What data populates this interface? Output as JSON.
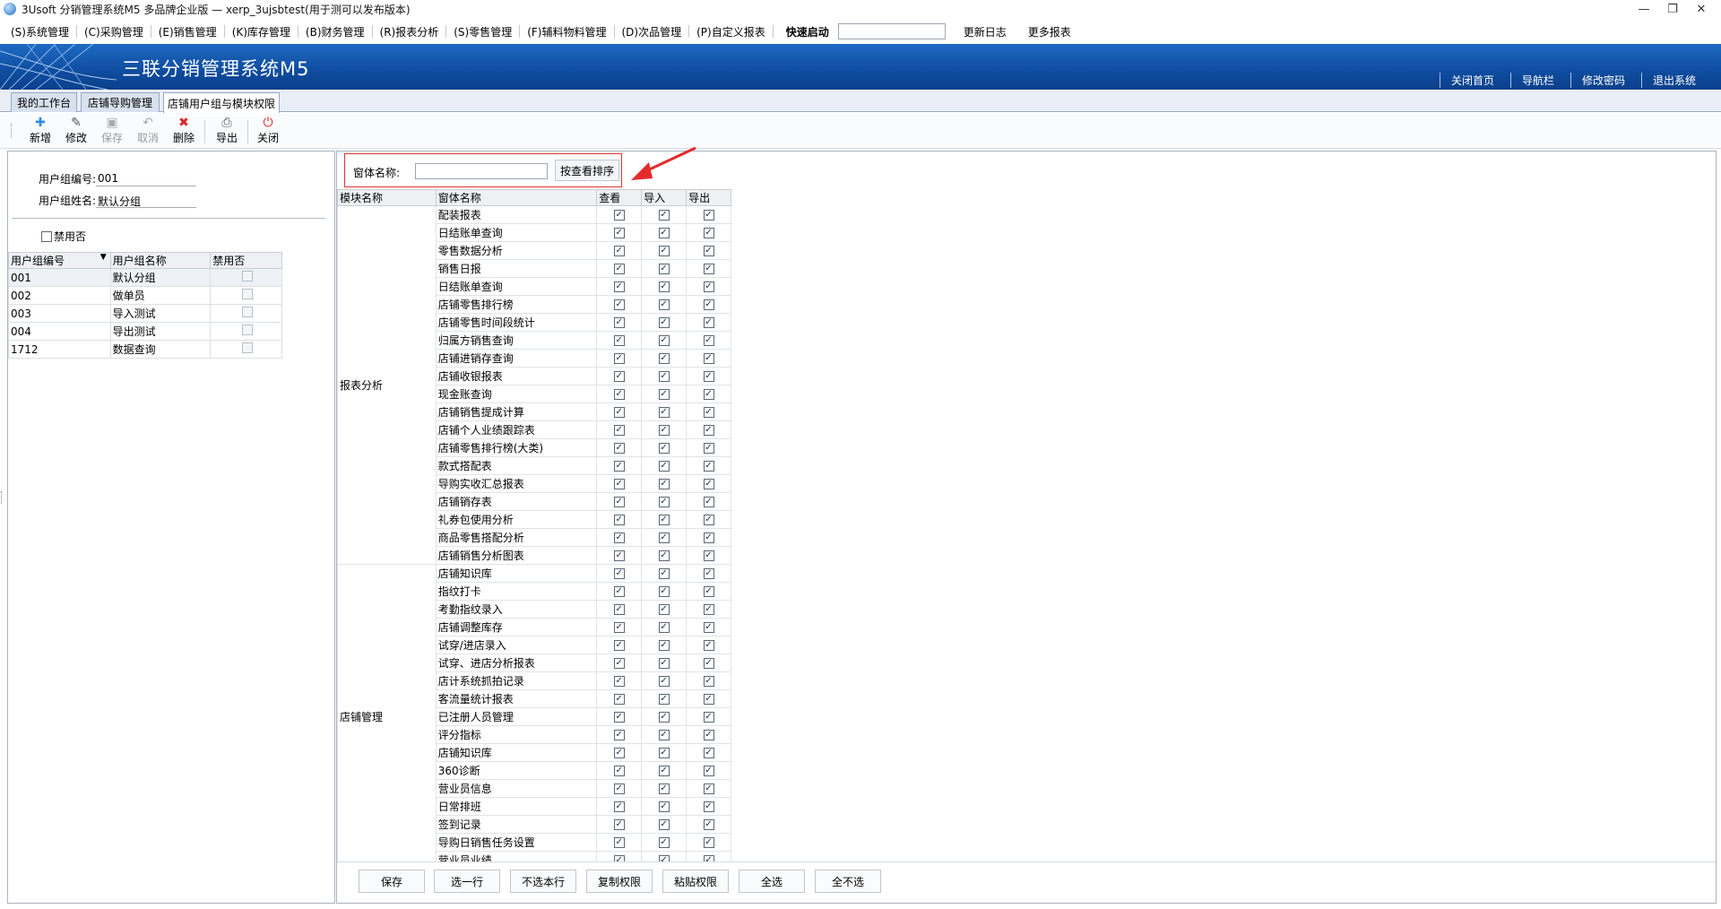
{
  "window": {
    "title": "3Usoft 分销管理系统M5 多品牌企业版 — xerp_3ujsbtest(用于测可以发布版本)",
    "buttons": [
      "—",
      "❐",
      "✕"
    ]
  },
  "menubar": {
    "items": [
      "(S)系统管理",
      "(C)采购管理",
      "(E)销售管理",
      "(K)库存管理",
      "(B)财务管理",
      "(R)报表分析",
      "(S)零售管理",
      "(F)辅料物料管理",
      "(D)次品管理",
      "(P)自定义报表"
    ],
    "quick_launch_label": "快速启动",
    "quick_launch_value": "",
    "extra_links": [
      "更新日志",
      "更多报表"
    ]
  },
  "banner": {
    "title": "三联分销管理系统M5",
    "links": [
      "关闭首页",
      "导航栏",
      "修改密码",
      "退出系统"
    ]
  },
  "tabs": [
    "我的工作台",
    "店铺导购管理",
    "店铺用户组与模块权限"
  ],
  "toolbar": {
    "new": "新增",
    "edit": "修改",
    "save": "保存",
    "cancel": "取消",
    "delete": "删除",
    "export": "导出",
    "close": "关闭"
  },
  "group_form": {
    "code_label": "用户组编号:",
    "code_value": "001",
    "name_label": "用户组姓名:",
    "name_value": "默认分组",
    "disabled_label": "禁用否"
  },
  "group_grid": {
    "headers": [
      "用户组编号",
      "用户组名称",
      "禁用否"
    ],
    "rows": [
      {
        "code": "001",
        "name": "默认分组"
      },
      {
        "code": "002",
        "name": "做单员"
      },
      {
        "code": "003",
        "name": "导入测试"
      },
      {
        "code": "004",
        "name": "导出测试"
      },
      {
        "code": "1712",
        "name": "数据查询"
      }
    ]
  },
  "search": {
    "label": "窗体名称:",
    "value": "",
    "button": "按查看排序"
  },
  "perm_grid": {
    "headers": [
      "模块名称",
      "窗体名称",
      "查看",
      "导入",
      "导出"
    ],
    "groups": [
      {
        "module": "报表分析",
        "forms": [
          "配装报表",
          "日结账单查询",
          "零售数据分析",
          "销售日报",
          "日结账单查询",
          "店铺零售排行榜",
          "店铺零售时间段统计",
          "归属方销售查询",
          "店铺进销存查询",
          "店铺收银报表",
          "现金账查询",
          "店铺销售提成计算",
          "店铺个人业绩跟踪表",
          "店铺零售排行榜(大类)",
          "款式搭配表",
          "导购实收汇总报表",
          "店铺销存表",
          "礼券包使用分析",
          "商品零售搭配分析",
          "店铺销售分析图表"
        ]
      },
      {
        "module": "店铺管理",
        "forms": [
          "店铺知识库",
          "指纹打卡",
          "考勤指纹录入",
          "店铺调整库存",
          "试穿/进店录入",
          "试穿、进店分析报表",
          "店计系统抓拍记录",
          "客流量统计报表",
          "已注册人员管理",
          "评分指标",
          "店铺知识库",
          "360诊断",
          "营业员信息",
          "日常排班",
          "签到记录",
          "导购日销售任务设置",
          "营业员业绩"
        ]
      }
    ]
  },
  "bottom_buttons": [
    "保存",
    "选一行",
    "不选本行",
    "复制权限",
    "粘贴权限",
    "全选",
    "全不选"
  ]
}
